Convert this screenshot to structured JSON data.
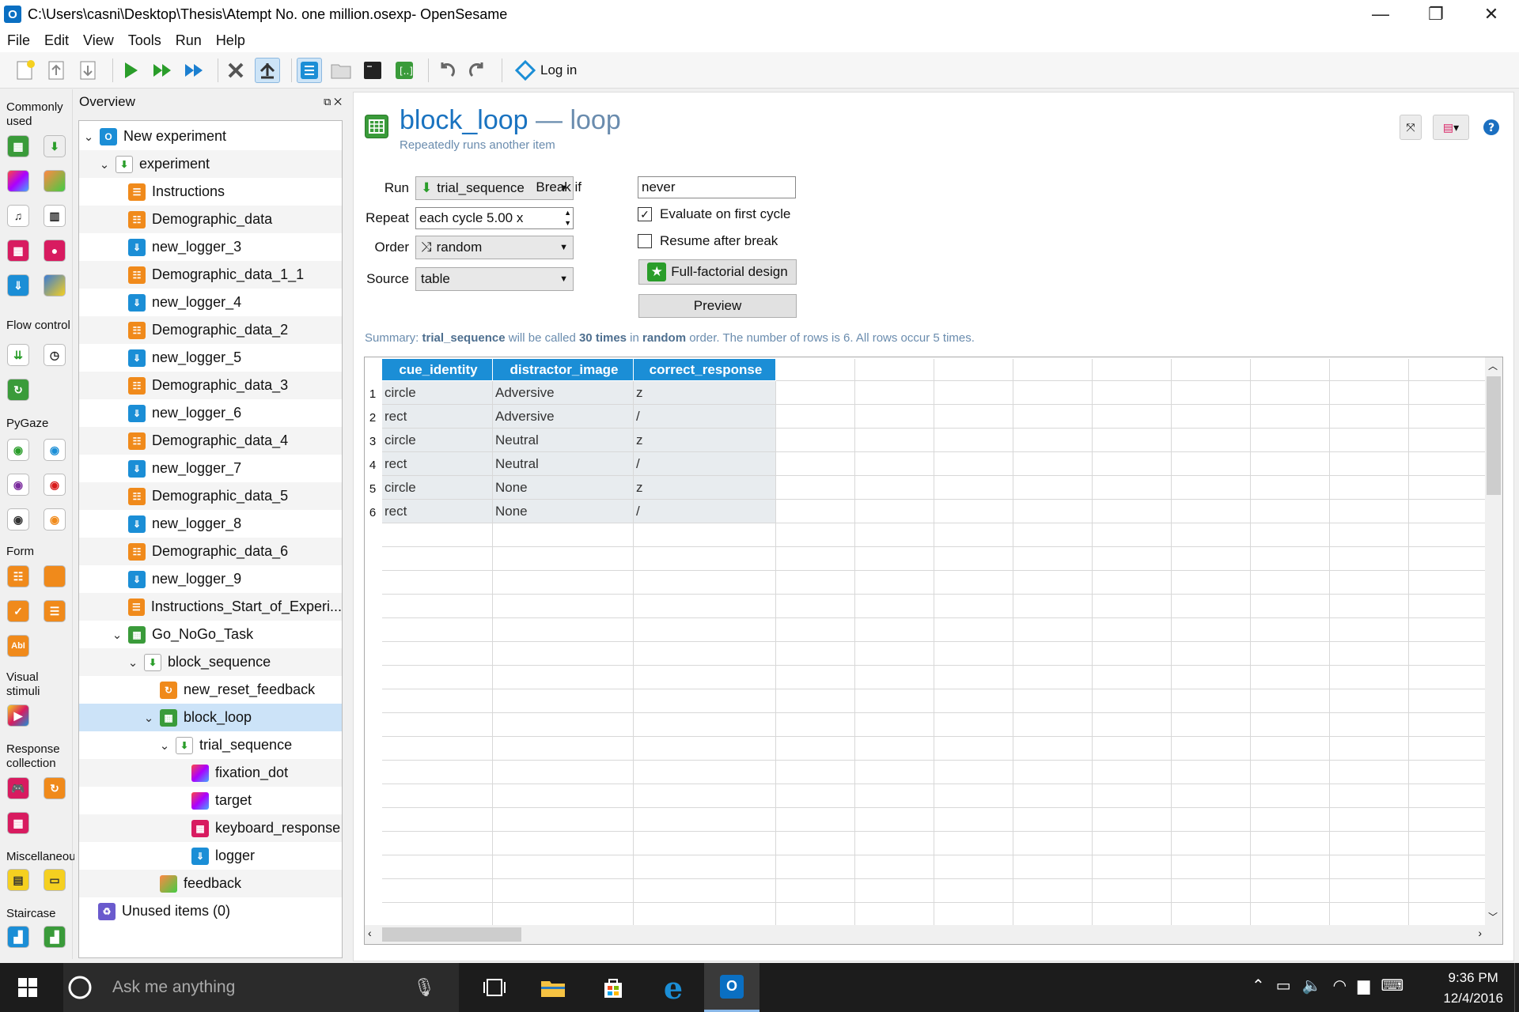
{
  "window": {
    "title": "C:\\Users\\casni\\Desktop\\Thesis\\Atempt No. one million.osexp- OpenSesame",
    "app_icon": "O"
  },
  "menu": [
    "File",
    "Edit",
    "View",
    "Tools",
    "Run",
    "Help"
  ],
  "toolbar": {
    "login_label": "Log in"
  },
  "palette": {
    "sections": [
      "Commonly used",
      "Flow control",
      "PyGaze",
      "Form",
      "Visual stimuli",
      "Response collection",
      "Miscellaneous",
      "Staircase"
    ]
  },
  "overview": {
    "title": "Overview",
    "items": [
      {
        "label": "New experiment"
      },
      {
        "label": "experiment"
      },
      {
        "label": "Instructions"
      },
      {
        "label": "Demographic_data"
      },
      {
        "label": "new_logger_3"
      },
      {
        "label": "Demographic_data_1_1"
      },
      {
        "label": "new_logger_4"
      },
      {
        "label": "Demographic_data_2"
      },
      {
        "label": "new_logger_5"
      },
      {
        "label": "Demographic_data_3"
      },
      {
        "label": "new_logger_6"
      },
      {
        "label": "Demographic_data_4"
      },
      {
        "label": "new_logger_7"
      },
      {
        "label": "Demographic_data_5"
      },
      {
        "label": "new_logger_8"
      },
      {
        "label": "Demographic_data_6"
      },
      {
        "label": "new_logger_9"
      },
      {
        "label": "Instructions_Start_of_Experi..."
      },
      {
        "label": "Go_NoGo_Task"
      },
      {
        "label": "block_sequence"
      },
      {
        "label": "new_reset_feedback"
      },
      {
        "label": "block_loop"
      },
      {
        "label": "trial_sequence"
      },
      {
        "label": "fixation_dot"
      },
      {
        "label": "target"
      },
      {
        "label": "keyboard_response"
      },
      {
        "label": "logger"
      },
      {
        "label": "feedback"
      },
      {
        "label": "Unused items (0)"
      }
    ]
  },
  "item": {
    "name": "block_loop",
    "type": "loop",
    "dash": "—",
    "description": "Repeatedly runs another item"
  },
  "form": {
    "run_label": "Run",
    "run_value": "trial_sequence",
    "repeat_label": "Repeat",
    "repeat_value": "each cycle 5.00 x",
    "order_label": "Order",
    "order_value": "random",
    "source_label": "Source",
    "source_value": "table",
    "break_label": "Break if",
    "break_value": "never",
    "eval_first_label": "Evaluate on first cycle",
    "resume_label": "Resume after break",
    "full_factorial_label": "Full-factorial design",
    "preview_label": "Preview"
  },
  "summary": {
    "p1": "Summary: ",
    "item": "trial_sequence",
    "p2": " will be called ",
    "times": "30 times",
    "p3": " in ",
    "order": "random",
    "p4": " order. The number of rows is 6. All rows occur 5 times."
  },
  "table": {
    "columns": [
      "cue_identity",
      "distractor_image",
      "correct_response"
    ],
    "rows": [
      [
        "circle",
        "Adversive",
        "z"
      ],
      [
        "rect",
        "Adversive",
        "/"
      ],
      [
        "circle",
        "Neutral",
        "z"
      ],
      [
        "rect",
        "Neutral",
        "/"
      ],
      [
        "circle",
        "None",
        "z"
      ],
      [
        "rect",
        "None",
        "/"
      ]
    ],
    "row_numbers": [
      "1",
      "2",
      "3",
      "4",
      "5",
      "6"
    ]
  },
  "taskbar": {
    "search_placeholder": "Ask me anything",
    "time": "9:36 PM",
    "date": "12/4/2016"
  },
  "colors": {
    "accent": "#1b8ed6",
    "title": "#1a73c0",
    "selection": "#cce3f8"
  }
}
